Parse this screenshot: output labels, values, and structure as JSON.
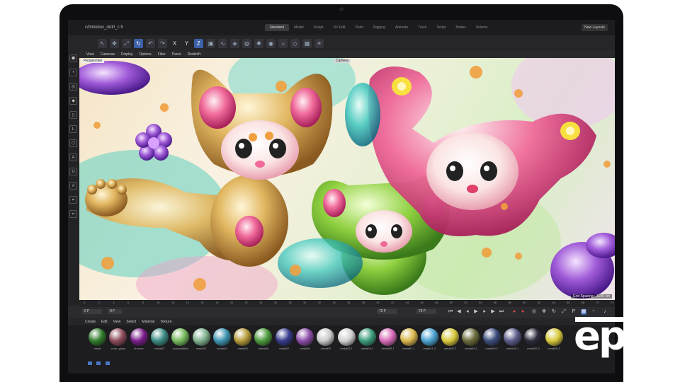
{
  "window": {
    "document_name": "c/thinkbox_drdrl_c.5"
  },
  "layouts": [
    "Standard",
    "Model",
    "Sculpt",
    "UV Edit",
    "Paint",
    "Rigging",
    "Animate",
    "Track",
    "Script",
    "Nodes",
    "Volume"
  ],
  "new_layouts_label": "New Layouts",
  "toolbar": {
    "axis_x": "X",
    "axis_y": "Y",
    "axis_z": "Z",
    "tools": [
      "pointer-icon",
      "move-icon",
      "scale-icon",
      "rotate-icon",
      "undo-icon",
      "redo-icon",
      "cube-icon",
      "spline-icon",
      "generator-icon",
      "deformer-icon",
      "field-icon",
      "camera-icon",
      "light-icon",
      "tag-icon",
      "grid-icon",
      "render-icon"
    ]
  },
  "viewport_menu": [
    "View",
    "Cameras",
    "Display",
    "Options",
    "Filter",
    "Panel",
    "Redshift"
  ],
  "viewport": {
    "perspective_label": "Perspective",
    "camera_label": "Camera",
    "grid_spacing": "Grid Spacing : 1000 cm"
  },
  "timeline": {
    "ticks": [
      "0",
      "2",
      "4",
      "6",
      "8",
      "10",
      "12",
      "14",
      "16",
      "18",
      "20",
      "22",
      "24",
      "26",
      "28",
      "30",
      "32",
      "34",
      "36",
      "38",
      "40",
      "42",
      "44",
      "46",
      "48",
      "50",
      "52",
      "54",
      "56",
      "58",
      "60",
      "62",
      "64",
      "66",
      "68",
      "70",
      "72"
    ]
  },
  "transport": {
    "start": "0 F",
    "current": "0 F",
    "end": "72 F",
    "end2": "72 F"
  },
  "material_menu": [
    "Create",
    "Edit",
    "View",
    "Select",
    "Material",
    "Texture"
  ],
  "materials": [
    {
      "name": "metal",
      "color": "#2f7a2a"
    },
    {
      "name": "color_glass",
      "color": "#8c4a5a"
    },
    {
      "name": "chrome",
      "color": "#7a1d8a"
    },
    {
      "name": "metal02",
      "color": "#3a8a82"
    },
    {
      "name": "colorediAlbe",
      "color": "#74b85a"
    },
    {
      "name": "metal03",
      "color": "#7fb08e"
    },
    {
      "name": "metal04",
      "color": "#3d94b0"
    },
    {
      "name": "metal05",
      "color": "#b59a3a"
    },
    {
      "name": "metal06",
      "color": "#4c9a3c"
    },
    {
      "name": "metal07",
      "color": "#353a8a"
    },
    {
      "name": "metal08",
      "color": "#8a4ca8"
    },
    {
      "name": "metal09",
      "color": "#c8c8c8"
    },
    {
      "name": "metal02.1",
      "color": "#d0d0d0"
    },
    {
      "name": "metal04.1",
      "color": "#3a9c7a"
    },
    {
      "name": "metal09.1",
      "color": "#d86ab8"
    },
    {
      "name": "metal01.1",
      "color": "#d8b64a"
    },
    {
      "name": "metal01.2",
      "color": "#4aa2d0"
    },
    {
      "name": "metal02.2",
      "color": "#d8c83a"
    },
    {
      "name": "metal04.2",
      "color": "#6a6a3a"
    },
    {
      "name": "metal09.2",
      "color": "#3a4a7a"
    },
    {
      "name": "metal05.1",
      "color": "#5a5a8a"
    },
    {
      "name": "metal02.3",
      "color": "#2a2a3a"
    },
    {
      "name": "metal09.3",
      "color": "#d8c83a"
    }
  ],
  "watermark": "epa"
}
